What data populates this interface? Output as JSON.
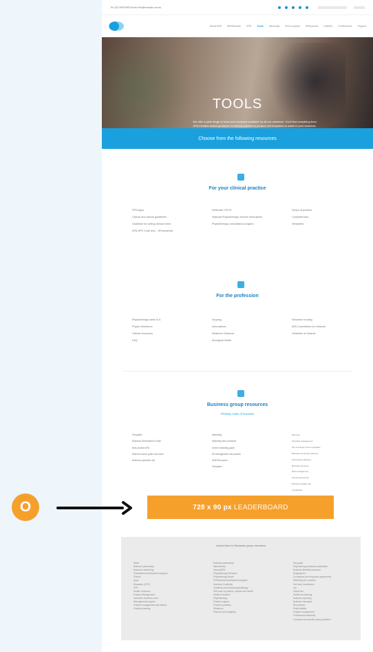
{
  "browser": {
    "topbar_text": "Tel: (02) 9699 9900 Email: info@example.com.au",
    "social_icons": [
      "facebook-icon",
      "twitter-icon",
      "linkedin-icon",
      "instagram-icon",
      "youtube-icon"
    ]
  },
  "nav": {
    "items": [
      "About APA",
      "Membership",
      "CPD",
      "Tools",
      "Advocacy",
      "Find a physio",
      "APA journal",
      "Careers",
      "Conferences",
      "Support"
    ],
    "active_index": 3
  },
  "hero": {
    "title": "TOOLS",
    "description": "We offer a wide range of tools and resources available for all our members. You'll find everything from APA member-based guidance for clinical practice to product and templates to assist in your business."
  },
  "banner": {
    "text": "Choose from the following resources"
  },
  "sections": {
    "clinical": {
      "title": "For your clinical practice",
      "col1": [
        "PPN Apps",
        "Clinical and clinical guidelines",
        "Guideline for writing clinical notes",
        "APA NPS Code and... (Pharmacist)"
      ],
      "col2": [
        "Reflective CPCS",
        "National Physiotherapy Service Descriptors",
        "Physiotherapy consultation program"
      ],
      "col3": [
        "Scope of practice",
        "Competencies",
        "Templates"
      ]
    },
    "profession": {
      "title": "For the profession",
      "col1": [
        "Physiotherapy week in A",
        "Physio Workforce",
        "Clinical resources",
        "FAQ"
      ],
      "col2": [
        "Scoping",
        "Informatives",
        "Medicine Guidance",
        "Aboriginal health"
      ],
      "col3": [
        "Research funding",
        "APA Committees for Network",
        "Guideline on Boards"
      ]
    },
    "business": {
      "title": "Business group resources",
      "subtitle": "Primary Care of success",
      "col1": [
        "Templates",
        "Business Development Guide",
        "Best practice APA",
        "Staff and owner guide resources",
        "Business operation tool"
      ],
      "col2": [
        "Marketing",
        "Marketing and promotion",
        "Online marketing guide",
        "HR Management and policies",
        "Staff Resources",
        "Templates"
      ],
      "col3": [
        "Planning",
        "Financial management",
        "Tax and Super forms templates",
        "Business continuity planning",
        "Succession planning",
        "Business structure",
        "Risk management",
        "Human Resources",
        "Business budget tool",
        "Compliance",
        "Staff policies",
        "Professional Development and Mentoring"
      ]
    }
  },
  "leaderboard": {
    "size": "728 x 90 px",
    "label": "LEADERBOARD",
    "marker": "O",
    "color": "#f6a02c"
  },
  "footer": {
    "title": "Useful links for Business group members",
    "col1": [
      "Alerts",
      "Business partnership",
      "Business networking",
      "Professional development program",
      "Clinical",
      "Apps",
      "Education (CPD)",
      "CPD",
      "Health Consumer",
      "Practice Management",
      "Insurance business cover",
      "Management program",
      "Practice management and finance",
      "Practice planning"
    ],
    "col2": [
      "Business partnership",
      "Membership",
      "Journal APA",
      "Physiotherapy Research",
      "Physiotherapy Board",
      "Professional development program",
      "Business Continuity",
      "Guideline and ethical physiotherapy",
      "APA code of practice, policies and health",
      "Health Promotion",
      "Physiotherapy",
      "Practice support",
      "Practice operation",
      "Workforce",
      "Finance and budgeting"
    ],
    "col3": [
      "Pay guide",
      "Physiotherapy Business publication",
      "Business Benefits insurance",
      "Employment",
      "Contractors and employee agreements",
      "Marketing your practice",
      "Fair work commission",
      "Tax",
      "Payroll tax",
      "Workforce planning",
      "Business reporting",
      "Business Insurance",
      "Recruitment",
      "Public liability",
      "Practice management",
      "Professional indemnity",
      "Contracts and practice policy guidance"
    ]
  }
}
